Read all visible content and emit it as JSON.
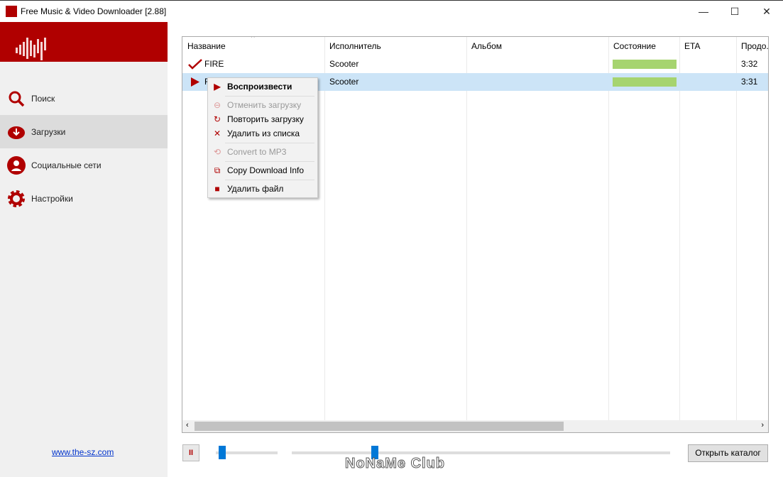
{
  "window": {
    "title": "Free Music & Video Downloader [2.88]",
    "minimize": "—",
    "maximize": "☐",
    "close": "✕"
  },
  "sidebar": {
    "items": [
      {
        "label": "Поиск",
        "icon": "search-icon"
      },
      {
        "label": "Загрузки",
        "icon": "cloud-download-icon",
        "active": true
      },
      {
        "label": "Социальные сети",
        "icon": "user-icon"
      },
      {
        "label": "Настройки",
        "icon": "gear-icon"
      }
    ],
    "link": "www.the-sz.com"
  },
  "table": {
    "columns": [
      "Название",
      "Исполнитель",
      "Альбом",
      "Состояние",
      "ETA",
      "Продо..."
    ],
    "rows": [
      {
        "status_icon": "check-icon",
        "title": "FIRE",
        "artist": "Scooter",
        "album": "",
        "progress": 1.0,
        "eta": "",
        "duration": "3:32"
      },
      {
        "status_icon": "play-icon",
        "title": "F",
        "artist": "Scooter",
        "album": "",
        "progress": 1.0,
        "eta": "",
        "duration": "3:31",
        "selected": true
      }
    ]
  },
  "context_menu": {
    "items": [
      {
        "label": "Воспроизвести",
        "icon": "play-icon",
        "bold": true
      },
      {
        "label": "Отменить загрузку",
        "icon": "cancel-icon",
        "disabled": true
      },
      {
        "label": "Повторить загрузку",
        "icon": "retry-icon"
      },
      {
        "label": "Удалить из списка",
        "icon": "close-icon"
      },
      {
        "label": "Convert to MP3",
        "icon": "convert-icon",
        "disabled": true
      },
      {
        "label": "Copy Download Info",
        "icon": "copy-icon"
      },
      {
        "label": "Удалить файл",
        "icon": "trash-icon"
      }
    ]
  },
  "player": {
    "pause": "II",
    "volume": 0.05,
    "position": 0.21,
    "open_folder": "Открыть каталог"
  },
  "watermark": "NoNaMe Club",
  "colors": {
    "accent": "#b00000",
    "progress": "#a6d46f",
    "selection": "#cce4f7",
    "slider": "#0078d7"
  }
}
